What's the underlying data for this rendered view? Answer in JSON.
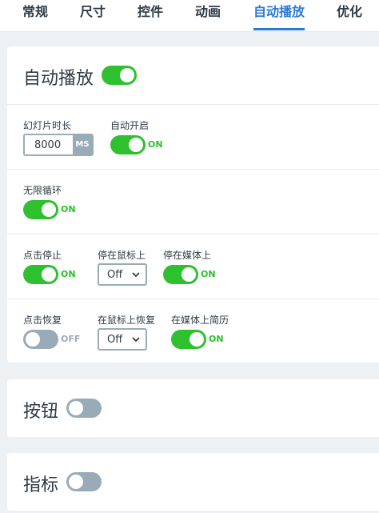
{
  "tabs": [
    {
      "label": "常规"
    },
    {
      "label": "尺寸"
    },
    {
      "label": "控件"
    },
    {
      "label": "动画"
    },
    {
      "label": "自动播放",
      "active": true
    },
    {
      "label": "优化"
    }
  ],
  "autoplay": {
    "title": "自动播放",
    "enabled": true,
    "slide_duration_label": "幻灯片时长",
    "slide_duration_value": "8000",
    "slide_duration_unit": "MS",
    "auto_start_label": "自动开启",
    "auto_start_state": "ON",
    "infinite_loop_label": "无限循环",
    "infinite_loop_state": "ON",
    "stop_on_click_label": "点击停止",
    "stop_on_click_state": "ON",
    "stop_on_hover_label": "停在鼠标上",
    "stop_on_hover_value": "Off",
    "stop_on_media_label": "停在媒体上",
    "stop_on_media_state": "ON",
    "resume_on_click_label": "点击恢复",
    "resume_on_click_state": "OFF",
    "resume_on_hover_label": "在鼠标上恢复",
    "resume_on_hover_value": "Off",
    "resume_on_media_label": "在媒体上简历",
    "resume_on_media_state": "ON"
  },
  "buttons": {
    "title": "按钮",
    "enabled": false
  },
  "indicators": {
    "title": "指标",
    "enabled": false
  },
  "colors": {
    "accent": "#2b7bd6",
    "on": "#2ec02e",
    "off": "#9aabb8"
  }
}
